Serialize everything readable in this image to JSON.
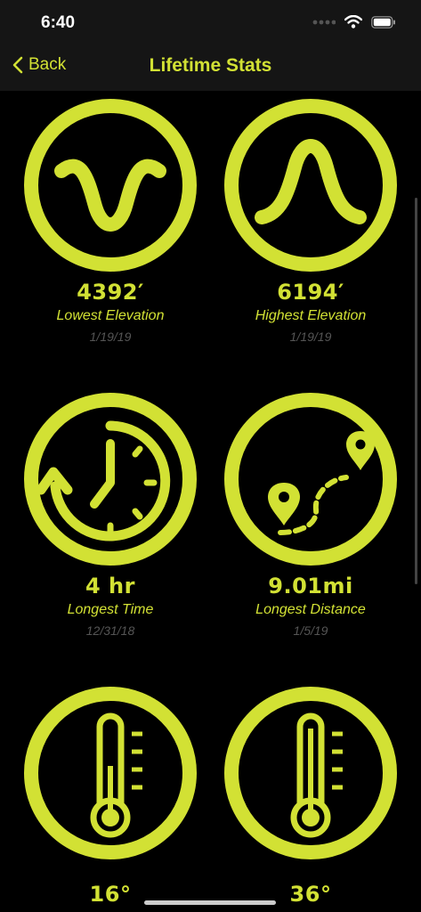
{
  "status": {
    "time": "6:40"
  },
  "nav": {
    "back_label": "Back",
    "title": "Lifetime Stats"
  },
  "accent_color": "#d2e134",
  "stats": [
    {
      "value": "4392′",
      "label": "Lowest Elevation",
      "date": "1/19/19",
      "icon": "valley-wave-icon"
    },
    {
      "value": "6194′",
      "label": "Highest Elevation",
      "date": "1/19/19",
      "icon": "peak-wave-icon"
    },
    {
      "value": "4 hr",
      "label": "Longest Time",
      "date": "12/31/18",
      "icon": "clock-history-icon"
    },
    {
      "value": "9.01mi",
      "label": "Longest Distance",
      "date": "1/5/19",
      "icon": "route-pins-icon"
    },
    {
      "value": "16°",
      "label": "",
      "date": "",
      "icon": "thermometer-low-icon"
    },
    {
      "value": "36°",
      "label": "",
      "date": "",
      "icon": "thermometer-high-icon"
    }
  ]
}
